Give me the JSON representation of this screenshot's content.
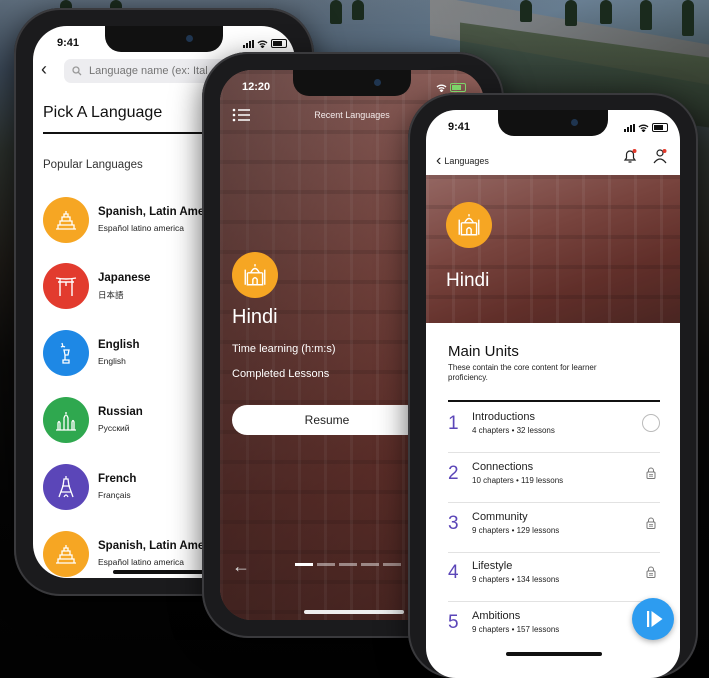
{
  "phone1": {
    "status_time": "9:41",
    "search_placeholder": "Language name (ex: Ital",
    "title": "Pick A Language",
    "section": "Popular Languages",
    "languages": [
      {
        "name": "Spanish, Latin Ame",
        "native": "Español latino america",
        "color": "#f6a623",
        "icon": "pyramid-icon"
      },
      {
        "name": "Japanese",
        "native": "日本語",
        "color": "#e23b2e",
        "icon": "torii-gate-icon"
      },
      {
        "name": "English",
        "native": "English",
        "color": "#1e88e5",
        "icon": "statue-of-liberty-icon"
      },
      {
        "name": "Russian",
        "native": "Русский",
        "color": "#2fa84f",
        "icon": "kremlin-icon"
      },
      {
        "name": "French",
        "native": "Français",
        "color": "#5b46b8",
        "icon": "eiffel-tower-icon"
      },
      {
        "name": "Spanish, Latin Ame",
        "native": "Español latino america",
        "color": "#f6a623",
        "icon": "pyramid-icon"
      }
    ]
  },
  "phone2": {
    "status_time": "12:20",
    "header": "Recent Languages",
    "language": "Hindi",
    "stat1": "Time learning (h:m:s)",
    "stat2": "Completed Lessons",
    "resume_label": "Resume"
  },
  "phone3": {
    "status_time": "9:41",
    "back_label": "Languages",
    "language": "Hindi",
    "section_title": "Main Units",
    "section_desc": "These contain the core content for learner proficiency.",
    "units": [
      {
        "num": "1",
        "title": "Introductions",
        "sub": "4 chapters  •  32 lessons",
        "state": "open"
      },
      {
        "num": "2",
        "title": "Connections",
        "sub": "10 chapters  •  119 lessons",
        "state": "locked"
      },
      {
        "num": "3",
        "title": "Community",
        "sub": "9 chapters  •  129 lessons",
        "state": "locked"
      },
      {
        "num": "4",
        "title": "Lifestyle",
        "sub": "9 chapters  •  134 lessons",
        "state": "locked"
      },
      {
        "num": "5",
        "title": "Ambitions",
        "sub": "9 chapters  •  157 lessons",
        "state": "locked"
      }
    ],
    "accent": "#5b46b8",
    "fab_color": "#2d9cf0"
  }
}
